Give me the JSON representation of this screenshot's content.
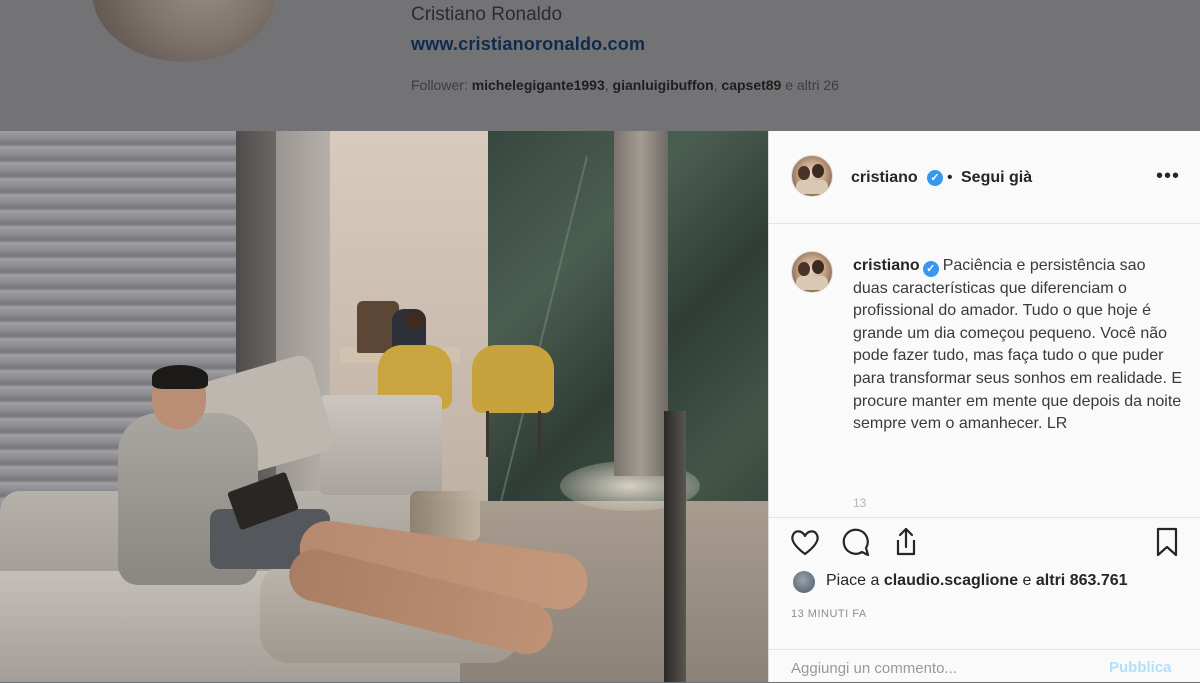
{
  "profile": {
    "name": "Cristiano Ronaldo",
    "website": "www.cristianoronaldo.com",
    "followers_prefix": "Follower:",
    "followers": [
      "michelegigante1993",
      "gianluigibuffon",
      "capset89"
    ],
    "followers_suffix": "e altri 26"
  },
  "post": {
    "username": "cristiano",
    "verified": true,
    "dot": "•",
    "follow_status": "Segui già",
    "more_icon": "ellipsis-icon",
    "caption": "Paciência e persistência sao duas características que diferenciam o profissional do amador. Tudo o que hoje é grande um dia começou pequeno. Você não pode fazer tudo, mas faça tudo o que puder para transformar seus sonhos em realidade. E procure manter em mente que depois da noite sempre vem o amanhecer. LR",
    "caption_overflow": "13",
    "likes_prefix": "Piace a",
    "likes_user": "claudio.scaglione",
    "likes_and": "e",
    "likes_count": "altri 863.761",
    "timestamp": "13 MINUTI FA",
    "comment_placeholder": "Aggiungi un commento...",
    "post_label": "Pubblica",
    "icons": [
      "heart-icon",
      "comment-icon",
      "share-icon",
      "bookmark-icon"
    ]
  },
  "colors": {
    "verified": "#3897f0",
    "post_button": "#b2dffc",
    "panel_background": "#fafafa",
    "overlay": "#737375"
  }
}
